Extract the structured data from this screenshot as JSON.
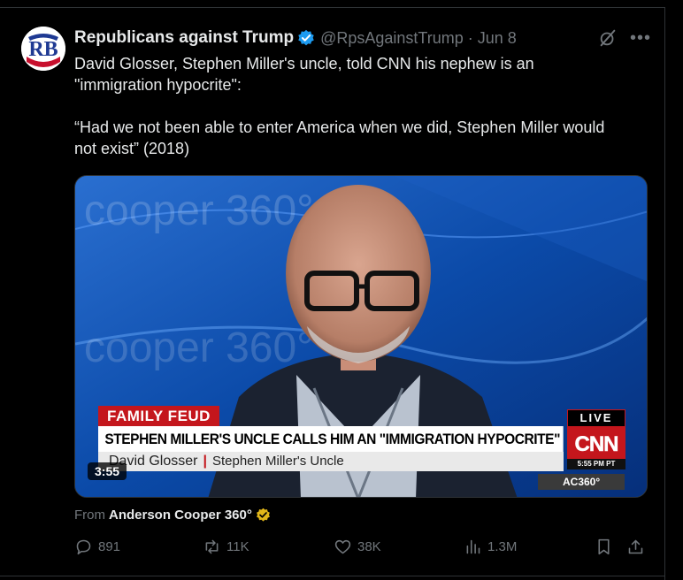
{
  "post": {
    "author_name": "Republicans against Trump",
    "handle_date": "@RpsAgainstTrump · Jun 8",
    "avatar_letters": "RB",
    "paragraphs": [
      "David Glosser, Stephen Miller's uncle, told CNN his nephew is an\n\"immigration hypocrite\":",
      "“Had we not been able to enter America when we did, Stephen Miller would\nnot exist” (2018)"
    ],
    "video": {
      "duration": "3:55",
      "chyron_tag": "FAMILY FEUD",
      "chyron_headline": "STEPHEN MILLER'S UNCLE CALLS HIM AN \"IMMIGRATION HYPOCRITE\"",
      "chyron_name": "David Glosser",
      "chyron_title": "Stephen Miller's Uncle",
      "live_label": "LIVE",
      "network_logo": "CNN",
      "broadcast_time": "5:55 PM PT",
      "show_bug": "AC360°",
      "watermark_text": "cooper 360°"
    },
    "from_label": "From",
    "from_source": "Anderson Cooper 360°",
    "actions": {
      "replies": "891",
      "reposts": "11K",
      "likes": "38K",
      "views": "1.3M"
    },
    "colors": {
      "background": "#000000",
      "text": "#e7e9ea",
      "muted": "#71767b",
      "verified_blue": "#1d9bf0",
      "verified_gold": "#e2b719",
      "cnn_red": "#c4161c"
    },
    "icons": [
      "verified-badge-icon",
      "grok-icon",
      "more-icon",
      "reply-icon",
      "repost-icon",
      "like-icon",
      "views-icon",
      "bookmark-icon",
      "share-icon",
      "gold-verified-icon"
    ]
  }
}
